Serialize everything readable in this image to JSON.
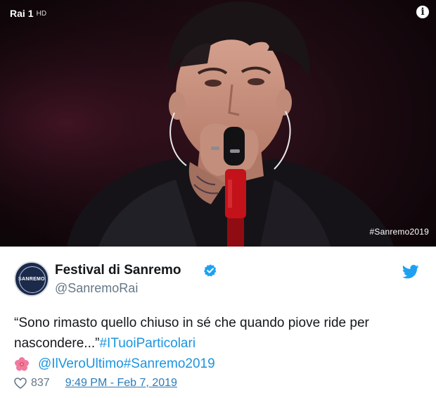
{
  "media": {
    "channel_logo": "Rai",
    "channel_number": "1",
    "channel_suffix": "HD",
    "info_label": "i",
    "overlay_hashtag": "#Sanremo2019"
  },
  "author": {
    "avatar_text": "SANREMO",
    "display_name": "Festival di Sanremo",
    "handle": "@SanremoRai",
    "verified": true
  },
  "tweet": {
    "text_part1": "“Sono rimasto quello chiuso in sé che quando piove ride per nascondere...”",
    "hashtag_1": "#ITuoiParticolari",
    "mention": "@IlVeroUltimo",
    "hashtag_2": "#Sanremo2019"
  },
  "footer": {
    "like_count": "837",
    "timestamp": "9:49 PM - Feb 7, 2019"
  },
  "colors": {
    "link": "#1b95e0",
    "verified": "#1da1f2",
    "muted": "#657786",
    "timestamp": "#2b7bb9"
  }
}
